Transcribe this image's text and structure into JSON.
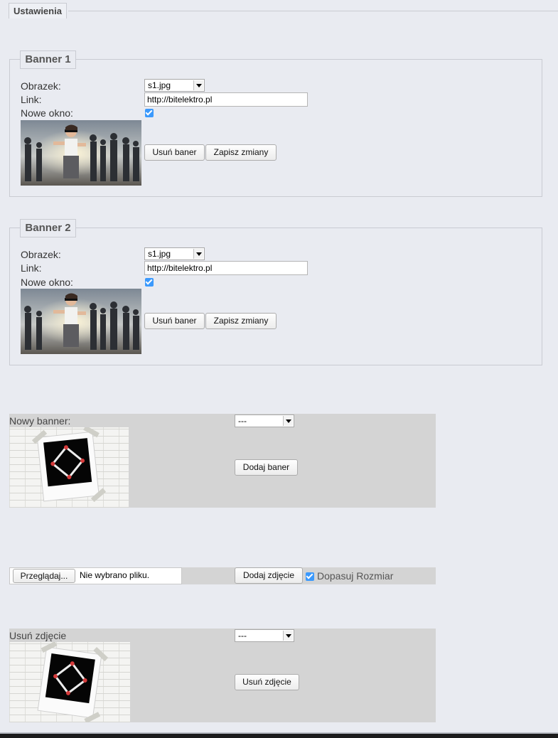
{
  "tab": {
    "label": "Ustawienia"
  },
  "banners": [
    {
      "legend": "Banner 1",
      "image_label": "Obrazek:",
      "image_value": "s1.jpg",
      "link_label": "Link:",
      "link_value": "http://bitelektro.pl",
      "new_window_label": "Nowe okno:",
      "new_window_checked": true,
      "remove_label": "Usuń baner",
      "save_label": "Zapisz zmiany"
    },
    {
      "legend": "Banner 2",
      "image_label": "Obrazek:",
      "image_value": "s1.jpg",
      "link_label": "Link:",
      "link_value": "http://bitelektro.pl",
      "new_window_label": "Nowe okno:",
      "new_window_checked": true,
      "remove_label": "Usuń baner",
      "save_label": "Zapisz zmiany"
    }
  ],
  "new_banner": {
    "label": "Nowy banner:",
    "select_value": "---",
    "add_label": "Dodaj baner"
  },
  "upload": {
    "browse_label": "Przeglądaj...",
    "file_status": "Nie wybrano pliku.",
    "add_photo_label": "Dodaj zdjęcie",
    "fit_size_label": "Dopasuj Rozmiar",
    "fit_size_checked": true
  },
  "remove_photo": {
    "label": "Usuń zdjęcie",
    "select_value": "---",
    "remove_label": "Usuń zdjęcie"
  },
  "colors": {
    "page_bg": "#e9ebf1",
    "panel_bg": "#d4d4d4",
    "checkbox": "#3b99fc"
  }
}
